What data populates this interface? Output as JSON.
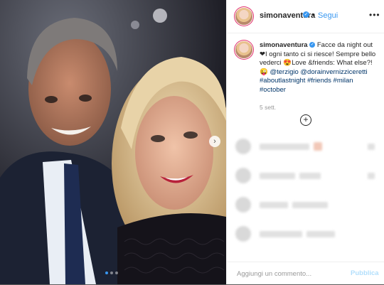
{
  "post": {
    "username": "simonaventura",
    "separator": "•",
    "follow_label": "Segui",
    "more_icon": "ellipsis-icon",
    "caption": {
      "author": "simonaventura",
      "text_1": "Facce da night out",
      "text_2": "I ogni tanto ci si riesce! Sempre bello vederci",
      "text_3": "Love &friends: What else?!",
      "emoji_heart": "❤",
      "emoji_love": "😍",
      "emoji_wink": "😜",
      "mentions": [
        "@terzigio",
        "@dorainvernizziceretti"
      ],
      "hashtags": [
        "#aboutlastnight",
        "#friends",
        "#milan",
        "#october"
      ]
    },
    "time": "5 sett.",
    "load_more_icon": "plus-circle-icon"
  },
  "comment_box": {
    "placeholder": "Aggiungi un commento...",
    "publish_label": "Pubblica"
  },
  "carousel": {
    "total": 3,
    "active_index": 0
  },
  "colors": {
    "accent": "#3897f0",
    "publish_disabled": "#b2dffc",
    "hashtag": "#003569"
  }
}
